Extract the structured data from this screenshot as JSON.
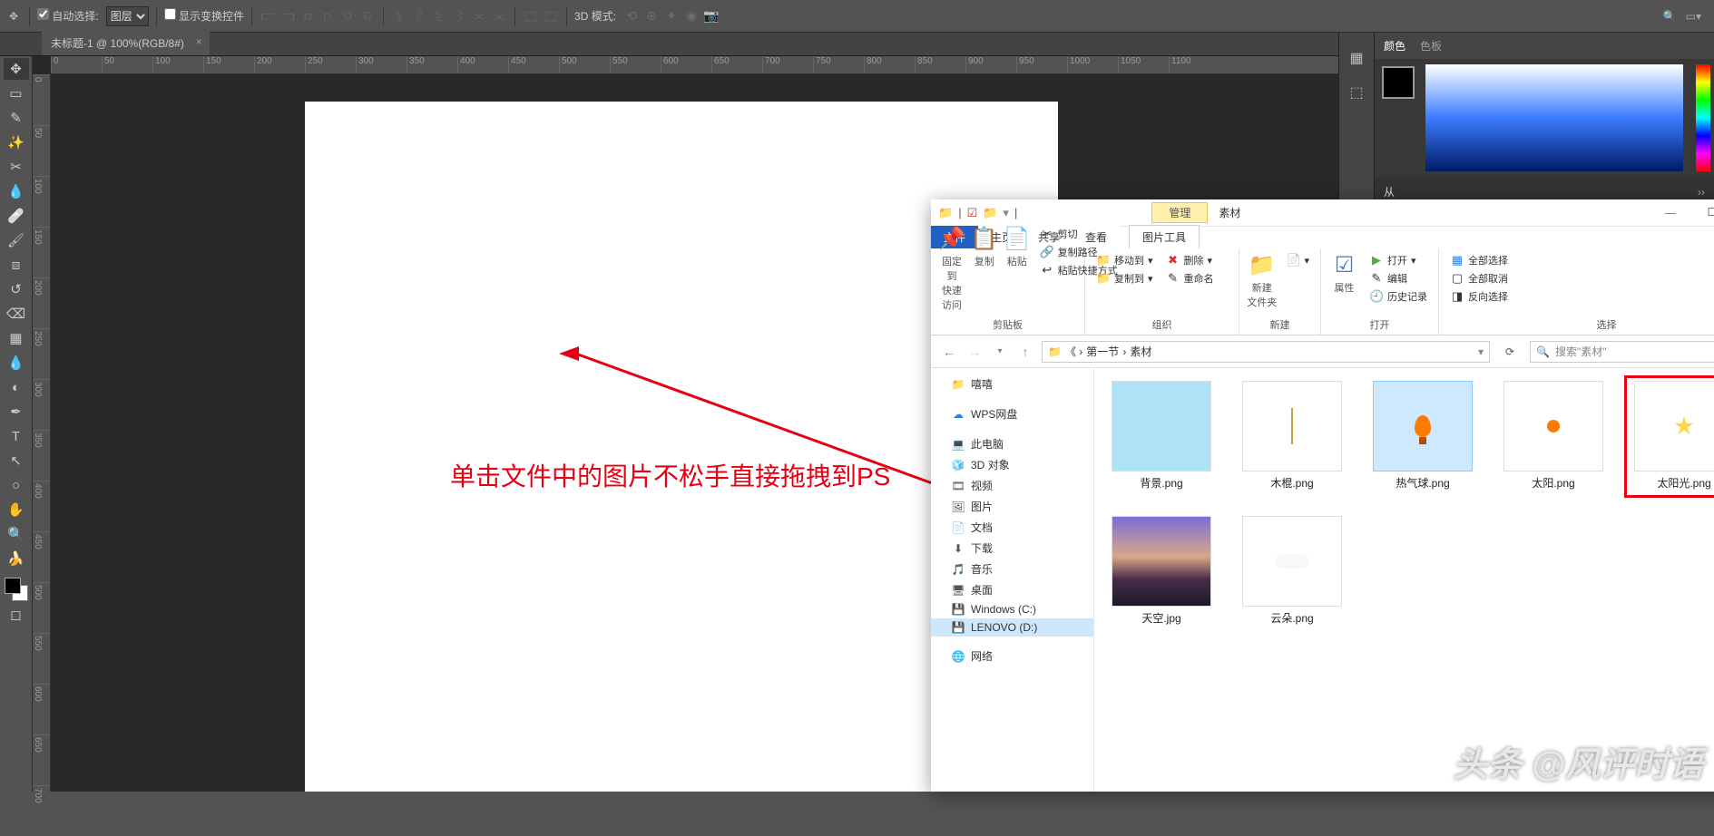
{
  "toolbar": {
    "auto_select": "自动选择:",
    "layer_dropdown": "图层",
    "show_transform": "显示变换控件",
    "mode_3d": "3D 模式:"
  },
  "tab": {
    "title": "未标题-1 @ 100%(RGB/8#)"
  },
  "ruler_h": [
    "0",
    "50",
    "100",
    "150",
    "200",
    "250",
    "300",
    "350",
    "400",
    "450",
    "500",
    "550",
    "600",
    "650",
    "700",
    "750",
    "800",
    "850",
    "900",
    "950",
    "1000",
    "1050",
    "1100"
  ],
  "ruler_v": [
    "0",
    "50",
    "100",
    "150",
    "200",
    "250",
    "300",
    "350",
    "400",
    "450",
    "500",
    "550",
    "600",
    "650",
    "700"
  ],
  "annotation": "单击文件中的图片不松手直接拖拽到PS",
  "right_panel": {
    "tab_color": "颜色",
    "tab_swatch": "色板",
    "collapse1": "从",
    "sections": [
      "",
      "",
      ""
    ]
  },
  "explorer": {
    "title_manage": "管理",
    "folder": "素材",
    "tabs": {
      "file": "文件",
      "home": "主页",
      "share": "共享",
      "view": "查看",
      "pic_tools": "图片工具"
    },
    "ribbon": {
      "pin": "固定到\n快速访问",
      "copy": "复制",
      "paste": "粘贴",
      "cut": "剪切",
      "copy_path": "复制路径",
      "paste_shortcut": "粘贴快捷方式",
      "group_clipboard": "剪贴板",
      "move_to": "移动到",
      "copy_to": "复制到",
      "delete": "删除",
      "rename": "重命名",
      "group_org": "组织",
      "new_folder": "新建\n文件夹",
      "group_new": "新建",
      "properties": "属性",
      "open": "打开",
      "edit": "编辑",
      "history": "历史记录",
      "group_open": "打开",
      "select_all": "全部选择",
      "select_none": "全部取消",
      "invert": "反向选择",
      "group_select": "选择"
    },
    "path": {
      "seg1": "第一节",
      "seg2": "素材"
    },
    "search_placeholder": "搜索\"素材\"",
    "tree": [
      {
        "icon": "📁",
        "label": "嘻嘻"
      },
      {
        "icon": "☁",
        "label": "WPS网盘",
        "color": "#2a84e8"
      },
      {
        "icon": "💻",
        "label": "此电脑",
        "color": "#3a7ecb"
      },
      {
        "icon": "🧊",
        "label": "3D 对象"
      },
      {
        "icon": "🎞",
        "label": "视频"
      },
      {
        "icon": "🖼",
        "label": "图片"
      },
      {
        "icon": "📄",
        "label": "文档"
      },
      {
        "icon": "⬇",
        "label": "下载"
      },
      {
        "icon": "🎵",
        "label": "音乐"
      },
      {
        "icon": "🖥",
        "label": "桌面"
      },
      {
        "icon": "💾",
        "label": "Windows (C:)"
      },
      {
        "icon": "💾",
        "label": "LENOVO (D:)",
        "sel": true
      },
      {
        "icon": "🌐",
        "label": "网络"
      }
    ],
    "files": [
      {
        "name": "背景.png",
        "cls": "th-bg"
      },
      {
        "name": "木棍.png",
        "cls": "th-stick"
      },
      {
        "name": "热气球.png",
        "cls": "th-balloon",
        "selected": true
      },
      {
        "name": "太阳.png",
        "cls": "th-sun"
      },
      {
        "name": "太阳光.png",
        "cls": "th-sunlight",
        "redbox": true
      },
      {
        "name": "天空.jpg",
        "cls": "th-sky"
      },
      {
        "name": "云朵.png",
        "cls": "th-cloud"
      }
    ]
  },
  "watermark": "头条 @风评时语"
}
